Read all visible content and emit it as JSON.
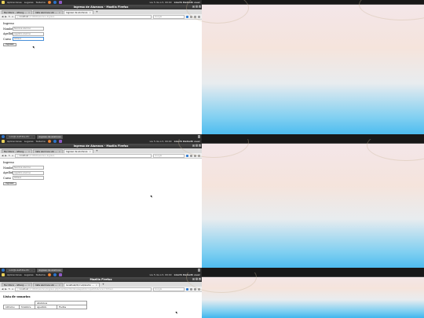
{
  "panel": {
    "menu_apps": "Aplicaciones",
    "menu_places": "Lugares",
    "menu_system": "Sistema",
    "clock": "vie 5 de oct, 09:40",
    "user": "Lizeth Daibeth ouer"
  },
  "frames": [
    {
      "window_title": "Ingreso de Alumnos - Mozilla Firefox",
      "tabs": [
        "Escritorio - ixtlacg ...",
        "lista alumnos ubi ...",
        "Ingreso de alumnos"
      ],
      "url_host": "localhost",
      "url_path": "/2 CRUD/alumno-Ingreso",
      "search_placeholder": "Google",
      "form": {
        "heading": "Ingreso",
        "nombre_label": "Nombre",
        "nombre_placeholder": "Nombre Alumno",
        "apellido_label": "Apellido",
        "apellido_placeholder": "Apellido Alumno",
        "curso_label": "Curso",
        "curso_value": "Octavo",
        "submit_label": "Ingresar"
      },
      "taskbar": [
        "root@LizethDai-PC: ...",
        "Ingreso de alumnos"
      ]
    },
    {
      "window_title": "Ingreso de Alumnos - Mozilla Firefox",
      "tabs": [
        "Escritorio - ixtlacg ...",
        "lista alumnos ubi ...",
        "Ingreso de alumnos"
      ],
      "url_host": "localhost",
      "url_path": "/2 CRUD/alumno-Ingreso",
      "search_placeholder": "Google",
      "form": {
        "heading": "Ingreso",
        "nombre_label": "Nombre",
        "nombre_placeholder": "Nombre Alumno",
        "apellido_label": "Apellido",
        "apellido_placeholder": "Apellido Alumno",
        "curso_label": "Curso",
        "curso_value": "Octavo",
        "submit_label": "Ingresar"
      },
      "taskbar": [
        "root@LizethDai-PC: ...",
        "Ingreso de alumnos"
      ]
    },
    {
      "window_title": "Mozilla Firefox",
      "tabs": [
        "Escritorio - ixtlacg ...",
        "lista alumnos ubi ...",
        "localhost/2/crud/alumn ..."
      ],
      "url_host": "localhost",
      "url_path": "/2 CRUD/alumno/ingreso.php?nombre=Nombre&apellido=Apellido&curso=Octavo",
      "search_placeholder": "Google",
      "list": {
        "heading": "Lista de usuarios",
        "group_header": "Alumnos",
        "columns": [
          "idCurso",
          "Nombre",
          "Apellido",
          "Fecha"
        ]
      }
    }
  ]
}
